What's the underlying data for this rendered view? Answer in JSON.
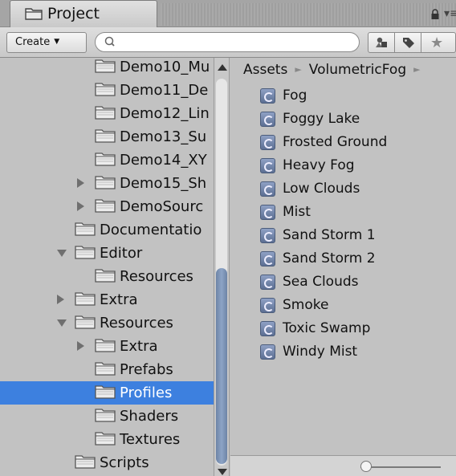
{
  "window": {
    "tab_title": "Project",
    "menu_glyph": "▾≡"
  },
  "toolbar": {
    "create_label": "Create",
    "create_arrow": "▼",
    "search": {
      "value": "",
      "placeholder": ""
    }
  },
  "tree": {
    "items": [
      {
        "label": "Demo10_Mu",
        "expand": "none",
        "depth": 2,
        "selected": false
      },
      {
        "label": "Demo11_De",
        "expand": "none",
        "depth": 2,
        "selected": false
      },
      {
        "label": "Demo12_Lin",
        "expand": "none",
        "depth": 2,
        "selected": false
      },
      {
        "label": "Demo13_Su",
        "expand": "none",
        "depth": 2,
        "selected": false
      },
      {
        "label": "Demo14_XY",
        "expand": "none",
        "depth": 2,
        "selected": false
      },
      {
        "label": "Demo15_Sh",
        "expand": "collapsed",
        "depth": 2,
        "selected": false
      },
      {
        "label": "DemoSourc",
        "expand": "collapsed",
        "depth": 2,
        "selected": false
      },
      {
        "label": "Documentatio",
        "expand": "none",
        "depth": 1,
        "selected": false
      },
      {
        "label": "Editor",
        "expand": "expanded",
        "depth": 1,
        "selected": false
      },
      {
        "label": "Resources",
        "expand": "none",
        "depth": 2,
        "selected": false
      },
      {
        "label": "Extra",
        "expand": "collapsed",
        "depth": 1,
        "selected": false
      },
      {
        "label": "Resources",
        "expand": "expanded",
        "depth": 1,
        "selected": false
      },
      {
        "label": "Extra",
        "expand": "collapsed",
        "depth": 2,
        "selected": false
      },
      {
        "label": "Prefabs",
        "expand": "none",
        "depth": 2,
        "selected": false
      },
      {
        "label": "Profiles",
        "expand": "none",
        "depth": 2,
        "selected": true
      },
      {
        "label": "Shaders",
        "expand": "none",
        "depth": 2,
        "selected": false
      },
      {
        "label": "Textures",
        "expand": "none",
        "depth": 2,
        "selected": false
      },
      {
        "label": "Scripts",
        "expand": "none",
        "depth": 1,
        "selected": false
      }
    ]
  },
  "breadcrumb": {
    "items": [
      "Assets",
      "VolumetricFog"
    ],
    "separator": "►"
  },
  "assets": {
    "items": [
      "Fog",
      "Foggy Lake",
      "Frosted Ground",
      "Heavy Fog",
      "Low Clouds",
      "Mist",
      "Sand Storm 1",
      "Sand Storm 2",
      "Sea Clouds",
      "Smoke",
      "Toxic Swamp",
      "Windy Mist"
    ]
  },
  "colors": {
    "selection": "#3d80df",
    "panel": "#c2c2c2",
    "scroll_thumb": "#7d94b6"
  }
}
